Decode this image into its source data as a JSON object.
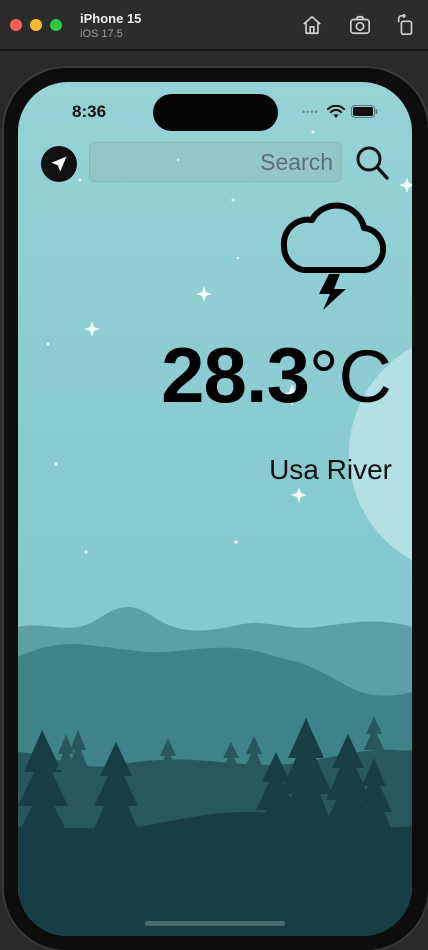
{
  "simulator": {
    "device_name": "iPhone 15",
    "os_version": "iOS 17.5",
    "controls": [
      "home-icon",
      "screenshot-icon",
      "rotate-icon"
    ]
  },
  "status_bar": {
    "time": "8:36",
    "signal": "••••"
  },
  "search": {
    "placeholder": "Search",
    "value": ""
  },
  "weather": {
    "condition_icon": "cloud-lightning-icon",
    "temperature_value": "28.3",
    "temperature_unit": "°C",
    "city": "Usa River"
  },
  "colors": {
    "sky_top": "#96d2d6",
    "sky_bottom": "#7fc2c8",
    "moon": "#b2e0e4",
    "hills_far": "#5ca0a5",
    "hills_mid": "#3f8288",
    "hills_near": "#28575d",
    "forest_dark": "#173e44"
  }
}
